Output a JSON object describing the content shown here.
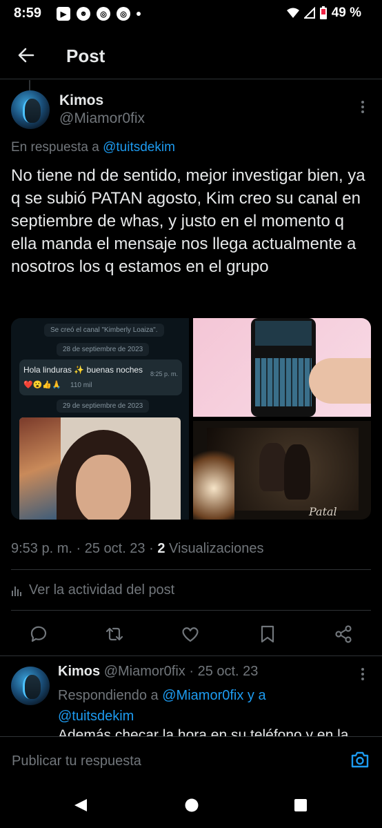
{
  "status_bar": {
    "time": "8:59",
    "battery": "49 %"
  },
  "header": {
    "title": "Post"
  },
  "post": {
    "author_name": "Kimos",
    "author_handle": "@Miamor0fix",
    "reply_prefix": "En respuesta a",
    "reply_to": "@tuitsdekim",
    "text": "No tiene nd de sentido, mejor investigar bien, ya q se subió PATAN agosto, Kim creo su canal en septiembre de whas, y justo en el momento q ella manda el mensaje nos llega actualmente a nosotros los q estamos en el grupo",
    "timestamp": "9:53 p. m. · 25 oct. 23 · ",
    "views_count": "2",
    "views_label": "Visualizaciones",
    "activity_label": "Ver la actividad del post"
  },
  "media": {
    "whatsapp": {
      "channel_created": "Se creó el canal \"Kimberly Loaiza\".",
      "date1": "28 de septiembre de 2023",
      "message": "Hola linduras ✨ buenas noches",
      "message_time": "8:25 p. m.",
      "reactions": "❤️😮👍🙏",
      "reactions_count": "110 mil",
      "date2": "29 de septiembre de 2023"
    },
    "poster_text": "Patal"
  },
  "reply_post": {
    "author_name": "Kimos",
    "author_handle": "@Miamor0fix",
    "date": "· 25 oct. 23",
    "replying_prefix": "Respondiendo a",
    "replying_to_1": "@Miamor0fix y a",
    "replying_to_2": "@tuitsdekim",
    "text_partial": "Además checar la hora en su teléfono y en la"
  },
  "compose": {
    "placeholder": "Publicar tu respuesta"
  },
  "colors": {
    "background": "#000000",
    "text": "#e7e9ea",
    "muted": "#71767b",
    "accent": "#1d9bf0",
    "divider": "#2f3336"
  }
}
